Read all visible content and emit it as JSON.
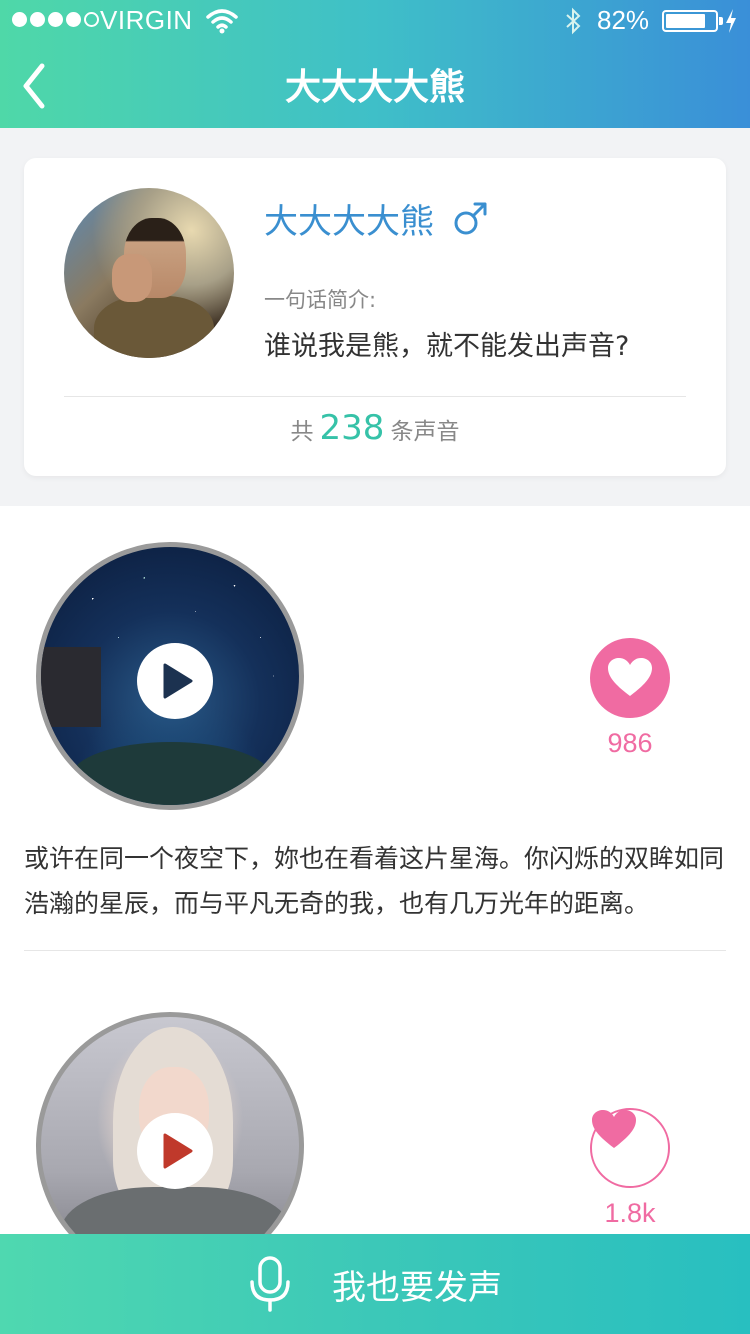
{
  "status_bar": {
    "carrier": "VIRGIN",
    "battery_percent": "82%",
    "battery_level": 0.82
  },
  "nav": {
    "title": "大大大大熊"
  },
  "profile": {
    "name": "大大大大熊",
    "gender_icon": "male-icon",
    "intro_label": "一句话简介:",
    "intro_text": "谁说我是熊，就不能发出声音?",
    "count_prefix": "共",
    "count": "238",
    "count_suffix": "条声音"
  },
  "posts": [
    {
      "likes": "986",
      "like_style": "filled",
      "text": "或许在同一个夜空下，妳也在看着这片星海。你闪烁的双眸如同浩瀚的星辰，而与平凡无奇的我，也有几万光年的距离。"
    },
    {
      "likes": "1.8k",
      "like_style": "outline",
      "text": ""
    }
  ],
  "bottom": {
    "label": "我也要发声"
  },
  "colors": {
    "accent_teal": "#36c2a8",
    "name_blue": "#3a8fd0",
    "like_pink": "#f06ba2"
  }
}
